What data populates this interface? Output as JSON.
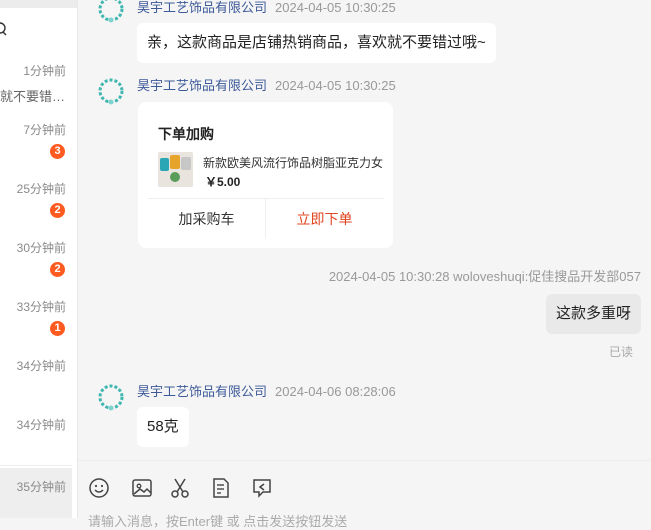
{
  "sidebar": {
    "items": [
      {
        "time": "1分钟前",
        "preview": "就不要错…",
        "badge": ""
      },
      {
        "time": "7分钟前",
        "preview": "",
        "badge": "3"
      },
      {
        "time": "25分钟前",
        "preview": "",
        "badge": "2"
      },
      {
        "time": "30分钟前",
        "preview": "",
        "badge": "2"
      },
      {
        "time": "33分钟前",
        "preview": "",
        "badge": "1"
      },
      {
        "time": "34分钟前",
        "preview": "",
        "badge": ""
      },
      {
        "time": "34分钟前",
        "preview": "",
        "badge": ""
      },
      {
        "time": "35分钟前",
        "preview": "",
        "badge": ""
      }
    ]
  },
  "chat": {
    "messages": [
      {
        "sender": "昊宇工艺饰品有限公司",
        "time": "2024-04-05 10:30:25",
        "text": "亲，这款商品是店铺热销商品，喜欢就不要错过哦~"
      },
      {
        "sender": "昊宇工艺饰品有限公司",
        "time": "2024-04-05 10:30:25"
      },
      {
        "sender": "昊宇工艺饰品有限公司",
        "time": "2024-04-06 08:28:06",
        "text": "58克"
      }
    ],
    "order_card": {
      "title": "下单加购",
      "product_name": "新款欧美风流行饰品树脂亚克力女",
      "price": "￥5.00",
      "add_cart_label": "加采购车",
      "buy_now_label": "立即下单"
    },
    "my_message": {
      "meta": "2024-04-05 10:30:28  woloveshuqi:促佳搜品开发部057",
      "text": "这款多重呀",
      "status": "已读"
    }
  },
  "toolbar": {
    "icons": [
      "emoji-icon",
      "image-icon",
      "scissors-icon",
      "document-icon",
      "history-icon"
    ],
    "placeholder": "请输入消息，按Enter键 或 点击发送按钮发送"
  },
  "colors": {
    "company_name": "#3d5a99",
    "badge": "#ff5a1f",
    "buy_button": "#e1441e"
  }
}
